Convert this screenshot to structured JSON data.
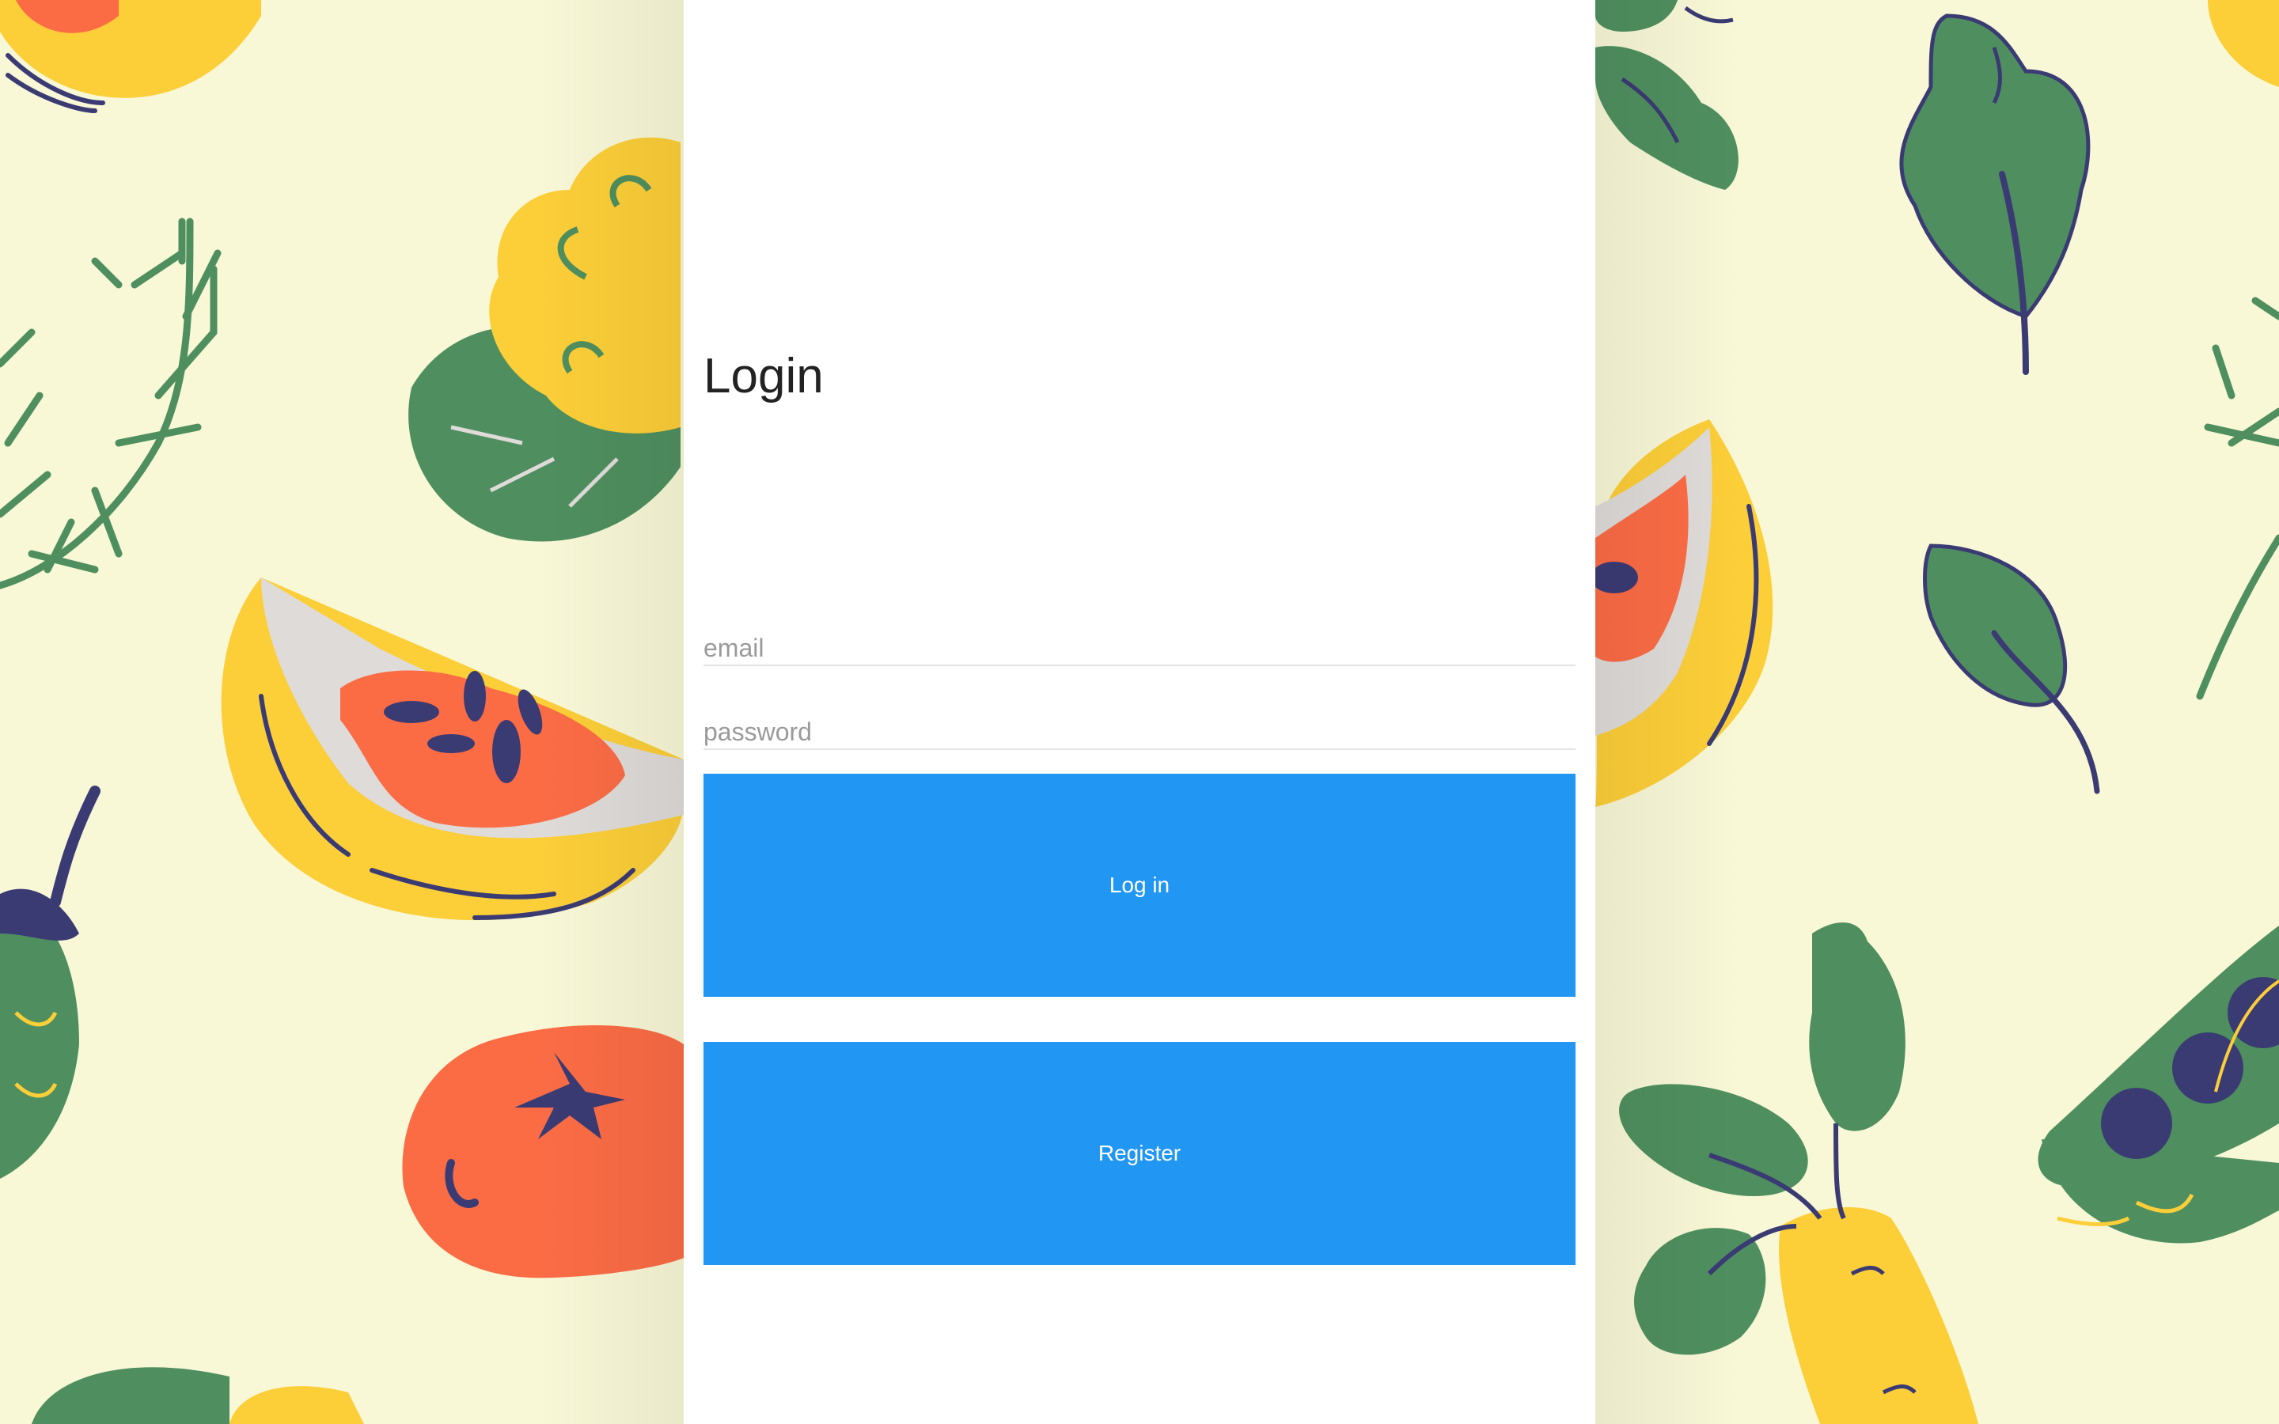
{
  "login_form": {
    "title": "Login",
    "email_placeholder": "email",
    "password_placeholder": "password",
    "login_label": "Log in",
    "register_label": "Register"
  },
  "background": {
    "pattern": "hand-drawn vegetables",
    "colors": {
      "cream": "#f8f7d6",
      "green": "#4f8f5f",
      "yellow": "#fcce38",
      "orange": "#fb6c45",
      "navy": "#3b3b74",
      "grey": "#dedbd8"
    }
  },
  "colors": {
    "button": "#2196f3",
    "button_text": "#ffffff",
    "panel": "#ffffff"
  }
}
